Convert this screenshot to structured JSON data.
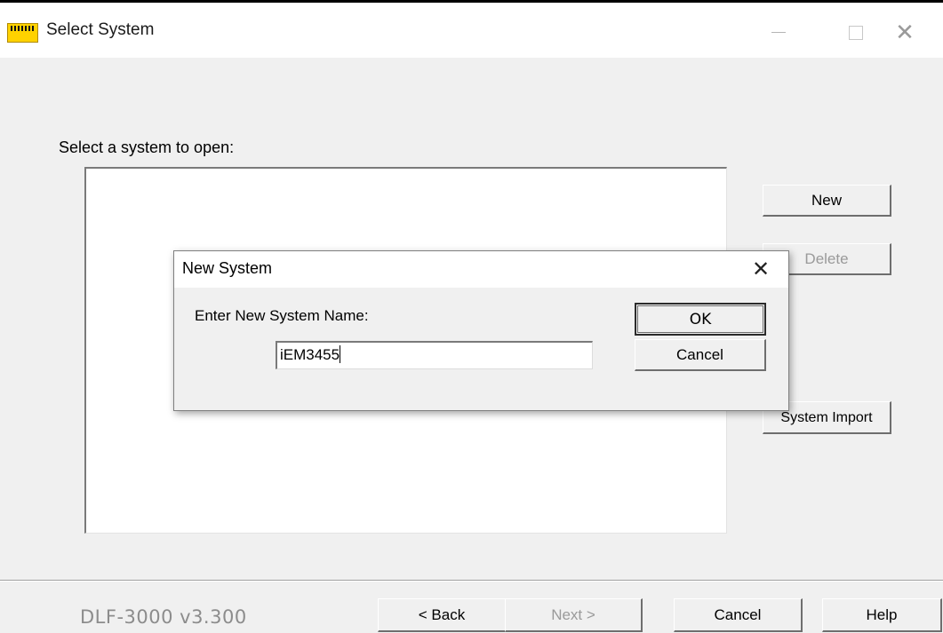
{
  "window": {
    "title": "Select System",
    "icon": "app-icon-yellow",
    "controls": {
      "minimize": "minimize-icon",
      "maximize": "maximize-icon",
      "close": "close-icon"
    }
  },
  "main": {
    "prompt": "Select a system to open:",
    "buttons": {
      "new": "New",
      "delete": "Delete",
      "system_import": "System Import"
    }
  },
  "footer": {
    "version": "DLF-3000 v3.300",
    "buttons": {
      "back": "< Back",
      "next": "Next >",
      "cancel": "Cancel",
      "help": "Help"
    }
  },
  "dialog": {
    "title": "New System",
    "label": "Enter New System Name:",
    "input_value": "iEM3455",
    "buttons": {
      "ok": "OK",
      "cancel": "Cancel"
    }
  }
}
